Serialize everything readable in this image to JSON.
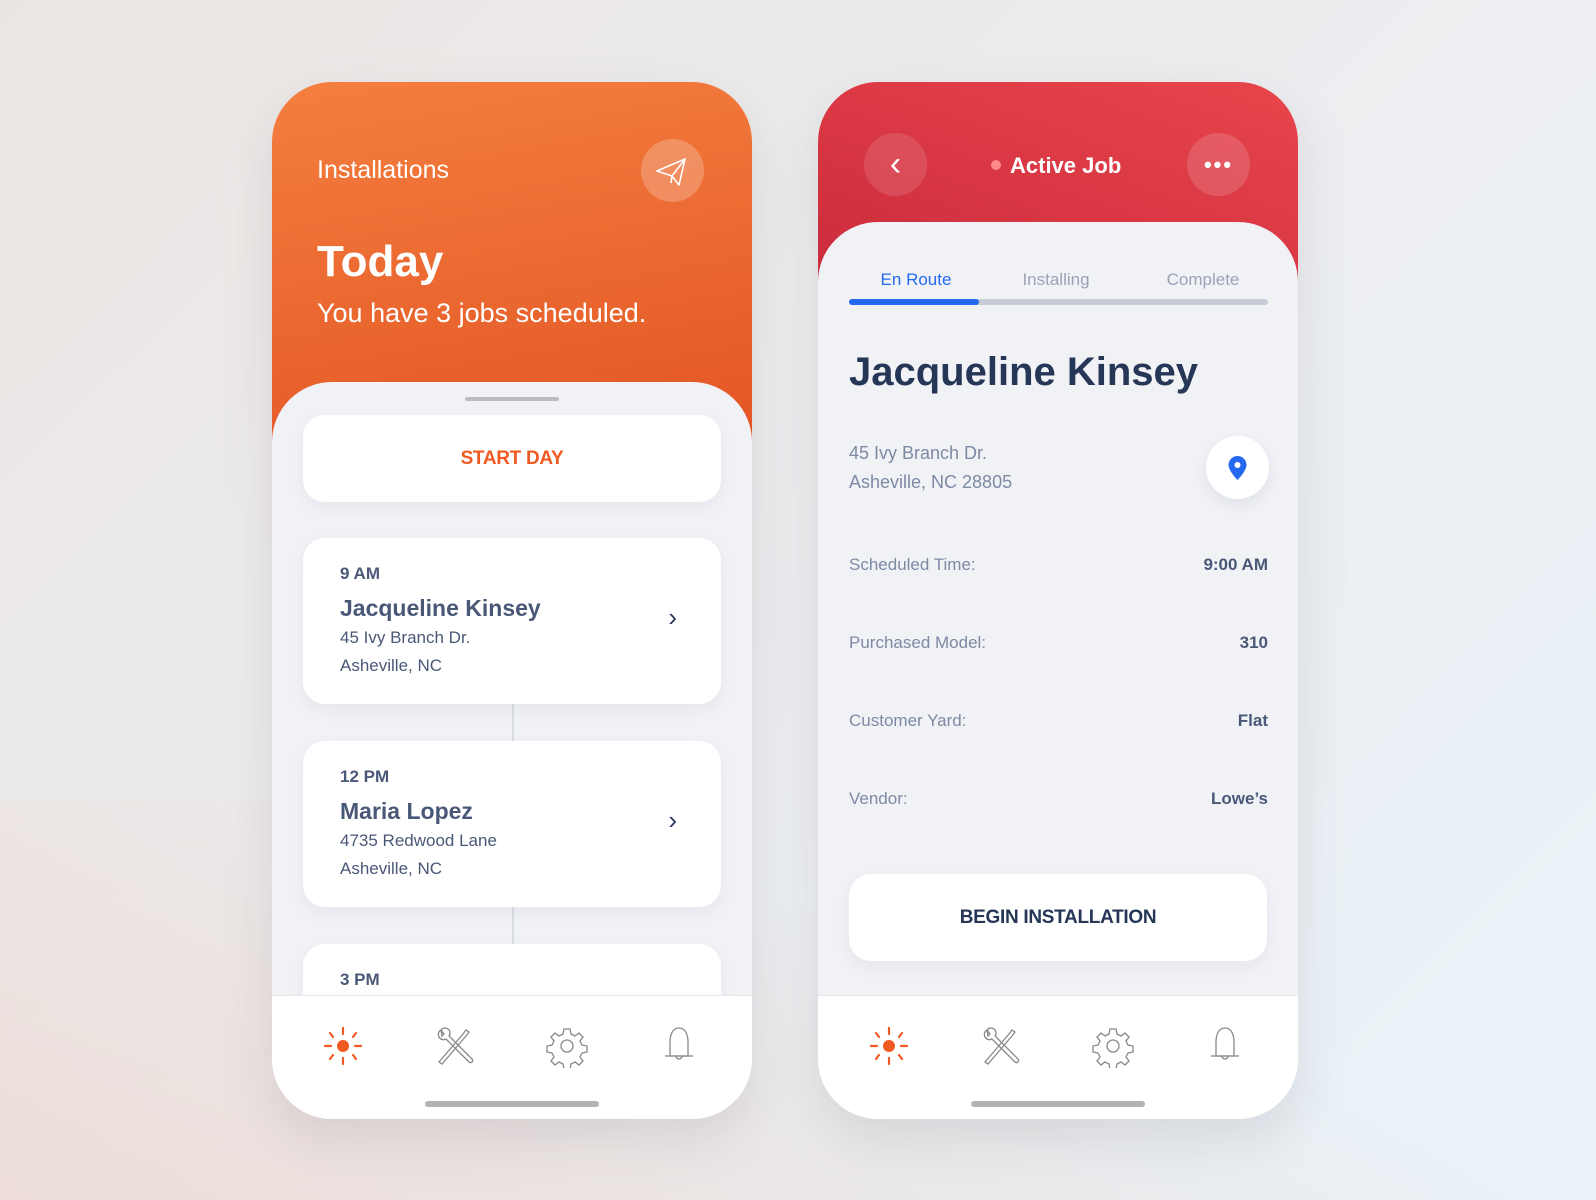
{
  "schedule": {
    "title": "Installations",
    "heading": "Today",
    "subtitle": "You have 3 jobs scheduled.",
    "start_label": "START DAY",
    "jobs": [
      {
        "time": "9 AM",
        "name": "Jacqueline Kinsey",
        "street": "45 Ivy Branch Dr.",
        "city": "Asheville, NC"
      },
      {
        "time": "12 PM",
        "name": "Maria Lopez",
        "street": "4735 Redwood Lane",
        "city": "Asheville, NC"
      },
      {
        "time": "3 PM"
      }
    ]
  },
  "active": {
    "title": "Active Job",
    "tabs": [
      "En Route",
      "Installing",
      "Complete"
    ],
    "active_tab": "En Route",
    "progress_fraction": 0.31,
    "customer": "Jacqueline Kinsey",
    "street": "45 Ivy Branch Dr.",
    "city": "Asheville, NC 28805",
    "details": [
      {
        "label": "Scheduled Time:",
        "value": "9:00 AM"
      },
      {
        "label": "Purchased Model:",
        "value": "310"
      },
      {
        "label": "Customer Yard:",
        "value": "Flat"
      },
      {
        "label": "Vendor:",
        "value": "Lowe’s"
      }
    ],
    "cta": "BEGIN INSTALLATION"
  },
  "nav_icons": [
    "sun-icon",
    "tools-icon",
    "gear-icon",
    "bell-icon"
  ],
  "colors": {
    "orange": "#e9602a",
    "red": "#d8343f",
    "blue": "#2569f0",
    "navy": "#263657"
  }
}
